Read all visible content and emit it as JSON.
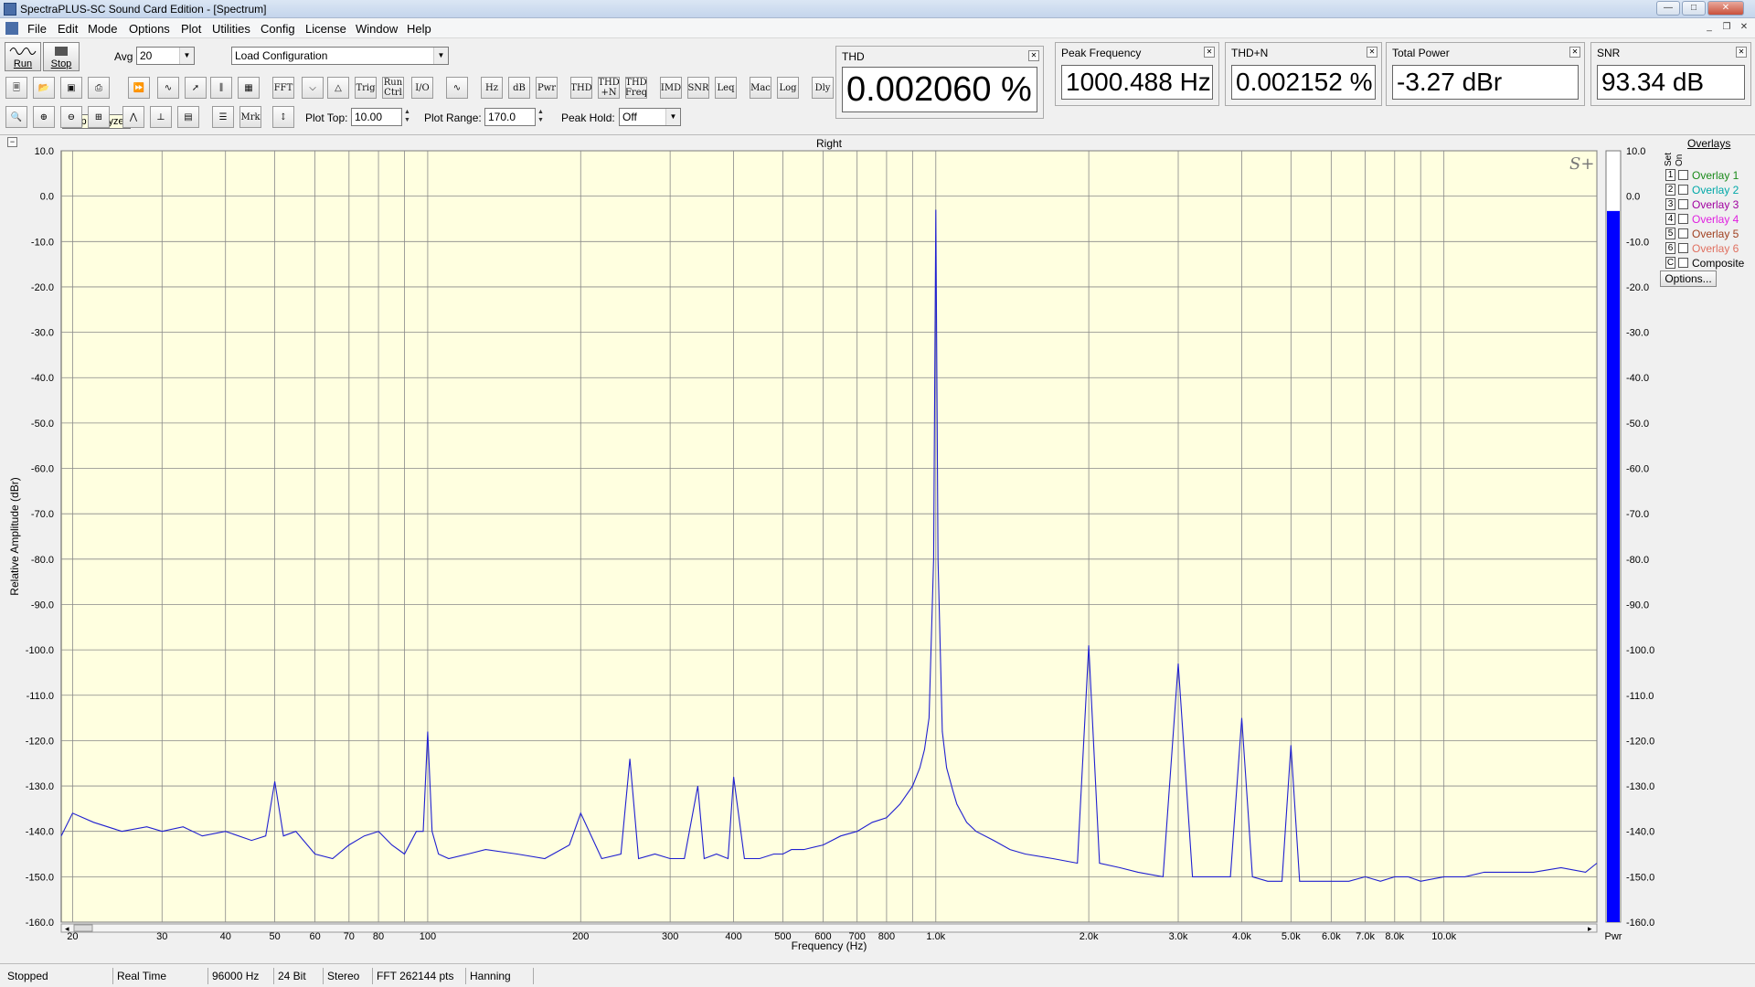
{
  "window": {
    "title": "SpectraPLUS-SC Sound Card Edition - [Spectrum]"
  },
  "menu": [
    "File",
    "Edit",
    "Mode",
    "Options",
    "Plot",
    "Utilities",
    "Config",
    "License",
    "Window",
    "Help"
  ],
  "toolbar": {
    "run_label": "Run",
    "stop_label": "Stop",
    "avg_label": "Avg",
    "avg_value": "20",
    "config_value": "Load Configuration",
    "tooltip": "Stop analyzer",
    "row2_buttons": [
      "FFT",
      "Trig",
      "Run Ctrl",
      "I/O",
      "Hz",
      "dB",
      "Pwr",
      "THD",
      "THD +N",
      "THD Freq",
      "IMD",
      "SNR",
      "Leq",
      "Mac",
      "Log",
      "Dly"
    ],
    "row3_buttons": [
      "Mrk"
    ],
    "plot_top_label": "Plot Top:",
    "plot_top_value": "10.00",
    "plot_range_label": "Plot Range:",
    "plot_range_value": "170.0",
    "peak_hold_label": "Peak Hold:",
    "peak_hold_value": "Off"
  },
  "meters": [
    {
      "title": "THD",
      "value": "0.002060 %"
    },
    {
      "title": "Peak Frequency",
      "value": "1000.488 Hz"
    },
    {
      "title": "THD+N",
      "value": "0.002152 %"
    },
    {
      "title": "Total Power",
      "value": "-3.27 dBr"
    },
    {
      "title": "SNR",
      "value": "93.34 dB"
    }
  ],
  "overlays": {
    "header": "Overlays",
    "set_label": "Set",
    "on_label": "On",
    "items": [
      {
        "num": "1",
        "label": "Overlay 1",
        "color": "#1a8a1a"
      },
      {
        "num": "2",
        "label": "Overlay 2",
        "color": "#00a8a8"
      },
      {
        "num": "3",
        "label": "Overlay 3",
        "color": "#a000a0"
      },
      {
        "num": "4",
        "label": "Overlay 4",
        "color": "#e020e0"
      },
      {
        "num": "5",
        "label": "Overlay 5",
        "color": "#a04020"
      },
      {
        "num": "6",
        "label": "Overlay 6",
        "color": "#e07060"
      },
      {
        "num": "C",
        "label": "Composite",
        "color": "#000000"
      }
    ],
    "options_label": "Options..."
  },
  "status": [
    "Stopped",
    "Real Time",
    "96000 Hz",
    "24 Bit",
    "Stereo",
    "FFT 262144 pts",
    "Hanning"
  ],
  "chart_data": {
    "type": "line",
    "title": "Right",
    "xlabel": "Frequency (Hz)",
    "ylabel": "Relative Amplitude (dBr)",
    "x_scale": "log",
    "xlim": [
      19,
      20000
    ],
    "ylim": [
      -160,
      10
    ],
    "grid": true,
    "background": "#ffffe0",
    "line_color": "#2020d0",
    "x_tick_labels": [
      {
        "v": 20,
        "t": "20"
      },
      {
        "v": 30,
        "t": "30"
      },
      {
        "v": 40,
        "t": "40"
      },
      {
        "v": 50,
        "t": "50"
      },
      {
        "v": 60,
        "t": "60"
      },
      {
        "v": 70,
        "t": "70"
      },
      {
        "v": 80,
        "t": "80"
      },
      {
        "v": 100,
        "t": "100"
      },
      {
        "v": 200,
        "t": "200"
      },
      {
        "v": 300,
        "t": "300"
      },
      {
        "v": 400,
        "t": "400"
      },
      {
        "v": 500,
        "t": "500"
      },
      {
        "v": 600,
        "t": "600"
      },
      {
        "v": 700,
        "t": "700"
      },
      {
        "v": 800,
        "t": "800"
      },
      {
        "v": 1000,
        "t": "1.0k"
      },
      {
        "v": 2000,
        "t": "2.0k"
      },
      {
        "v": 3000,
        "t": "3.0k"
      },
      {
        "v": 4000,
        "t": "4.0k"
      },
      {
        "v": 5000,
        "t": "5.0k"
      },
      {
        "v": 6000,
        "t": "6.0k"
      },
      {
        "v": 7000,
        "t": "7.0k"
      },
      {
        "v": 8000,
        "t": "8.0k"
      },
      {
        "v": 10000,
        "t": "10.0k"
      }
    ],
    "y_ticks": [
      10,
      0,
      -10,
      -20,
      -30,
      -40,
      -50,
      -60,
      -70,
      -80,
      -90,
      -100,
      -110,
      -120,
      -130,
      -140,
      -150,
      -160
    ],
    "y_tick_labels": [
      "10.0",
      "0.0",
      "-10.0",
      "-20.0",
      "-30.0",
      "-40.0",
      "-50.0",
      "-60.0",
      "-70.0",
      "-80.0",
      "-90.0",
      "-100.0",
      "-110.0",
      "-120.0",
      "-130.0",
      "-140.0",
      "-150.0",
      "-160.0"
    ],
    "series": [
      {
        "x": [
          19,
          20,
          22,
          25,
          28,
          30,
          33,
          36,
          40,
          45,
          48,
          50,
          52,
          55,
          60,
          65,
          70,
          75,
          80,
          85,
          90,
          95,
          98,
          100,
          102,
          105,
          110,
          120,
          130,
          150,
          170,
          190,
          200,
          220,
          240,
          250,
          260,
          280,
          300,
          320,
          340,
          350,
          370,
          390,
          400,
          420,
          450,
          480,
          500,
          520,
          550,
          600,
          650,
          700,
          750,
          800,
          850,
          900,
          930,
          950,
          970,
          990,
          1000,
          1010,
          1030,
          1050,
          1080,
          1100,
          1150,
          1200,
          1300,
          1400,
          1500,
          1700,
          1900,
          2000,
          2100,
          2300,
          2500,
          2800,
          3000,
          3200,
          3500,
          3800,
          4000,
          4200,
          4500,
          4800,
          5000,
          5200,
          5500,
          6000,
          6500,
          7000,
          7500,
          8000,
          8500,
          9000,
          10000,
          11000,
          12000,
          13000,
          15000,
          17000,
          19000,
          20000
        ],
        "y": [
          -141,
          -136,
          -138,
          -140,
          -139,
          -140,
          -139,
          -141,
          -140,
          -142,
          -141,
          -129,
          -141,
          -140,
          -145,
          -146,
          -143,
          -141,
          -140,
          -143,
          -145,
          -140,
          -140,
          -118,
          -140,
          -145,
          -146,
          -145,
          -144,
          -145,
          -146,
          -143,
          -136,
          -146,
          -145,
          -124,
          -146,
          -145,
          -146,
          -146,
          -130,
          -146,
          -145,
          -146,
          -128,
          -146,
          -146,
          -145,
          -145,
          -144,
          -144,
          -143,
          -141,
          -140,
          -138,
          -137,
          -134,
          -130,
          -126,
          -122,
          -115,
          -80,
          -3,
          -80,
          -118,
          -126,
          -131,
          -134,
          -138,
          -140,
          -142,
          -144,
          -145,
          -146,
          -147,
          -99,
          -147,
          -148,
          -149,
          -150,
          -103,
          -150,
          -150,
          -150,
          -115,
          -150,
          -151,
          -151,
          -121,
          -151,
          -151,
          -151,
          -151,
          -150,
          -151,
          -150,
          -150,
          -151,
          -150,
          -150,
          -149,
          -149,
          -149,
          -148,
          -149,
          -147
        ]
      }
    ],
    "side_meter": {
      "label": "Pwr",
      "value": -3.27,
      "ylim": [
        -160,
        10
      ]
    }
  }
}
